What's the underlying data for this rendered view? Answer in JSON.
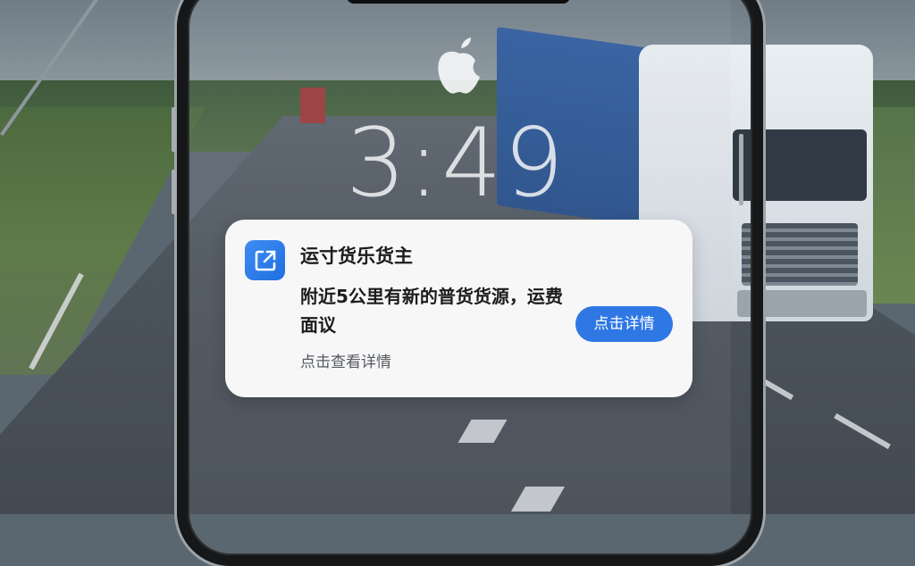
{
  "lock_screen": {
    "time": "3:49"
  },
  "notification": {
    "app_name": "运寸货乐货主",
    "message": "附近5公里有新的普货货源，运费面议",
    "hint": "点击查看详情",
    "action_label": "点击详情",
    "app_icon": "external-link-icon",
    "accent_color": "#2f78e4"
  }
}
